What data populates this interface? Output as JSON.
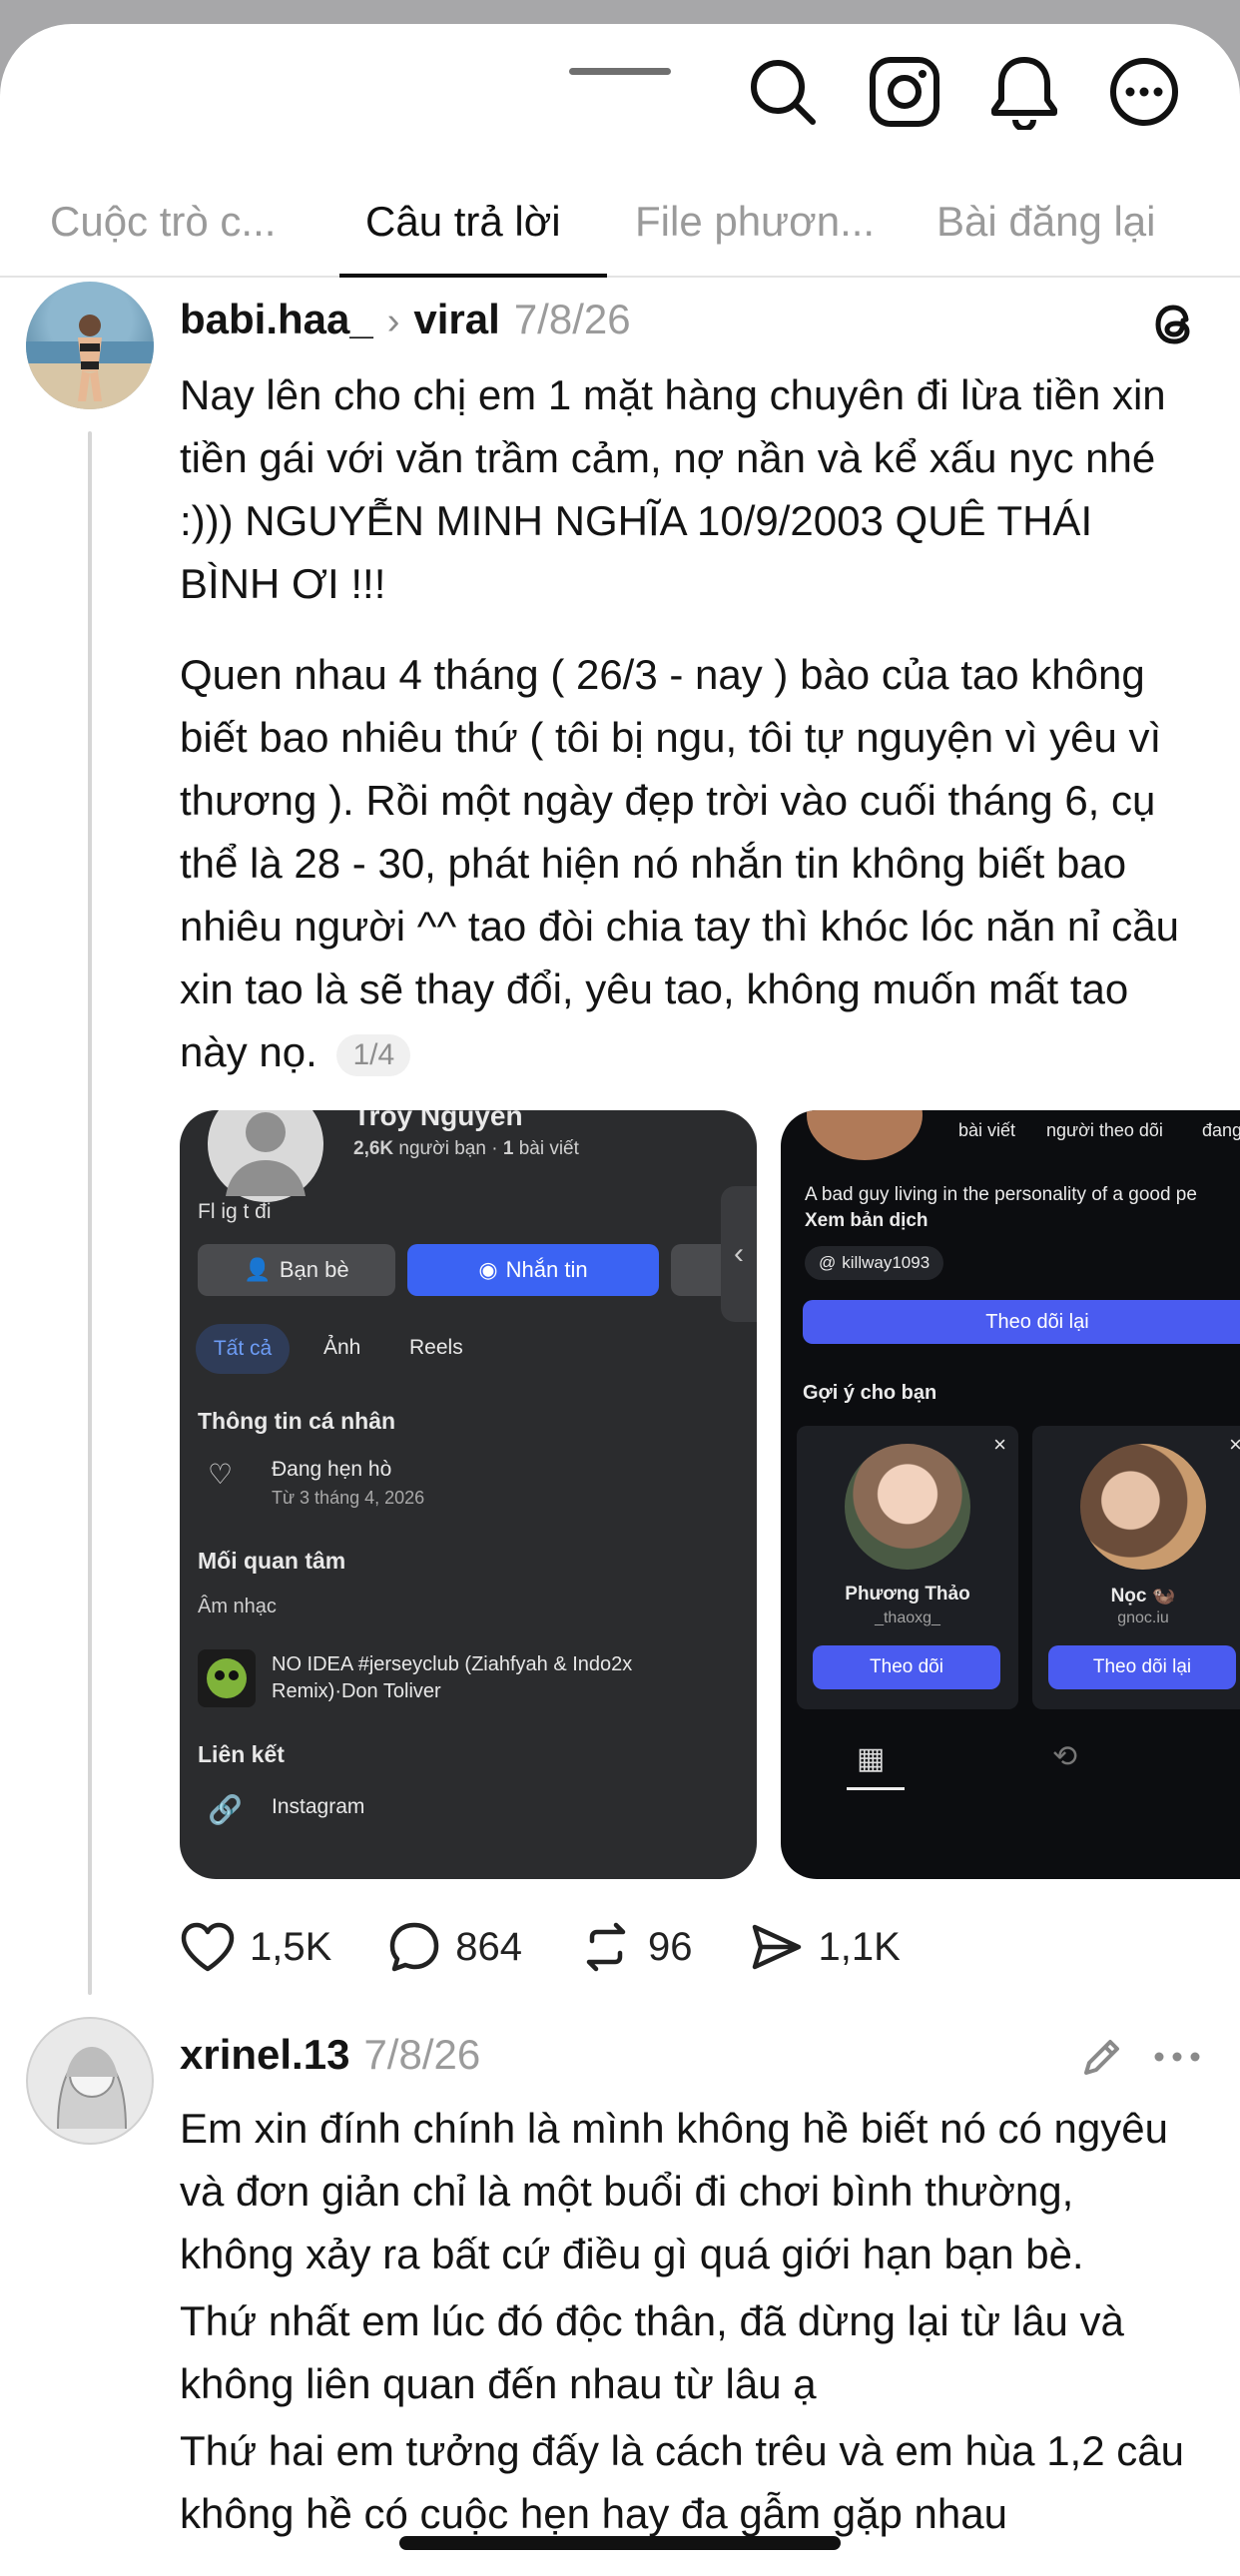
{
  "tabs": [
    "Cuộc trò c...",
    "Câu trả lời",
    "File phươn...",
    "Bài đăng lại"
  ],
  "post1": {
    "username": "babi.haa_",
    "topic": "viral",
    "date": "7/8/26",
    "para1": "Nay lên cho chị em 1 mặt hàng chuyên đi lừa tiền xin tiền gái với văn trầm cảm, nợ nần và kể xấu nyc nhé :))) NGUYỄN MINH NGHĨA 10/9/2003 QUÊ THÁI BÌNH ƠI !!!",
    "para2": "Quen nhau 4 tháng ( 26/3 - nay ) bào của tao không biết bao nhiêu thứ ( tôi bị ngu, tôi tự nguyện vì yêu vì thương ). Rồi một ngày đẹp trời vào cuối tháng 6, cụ thể là 28 - 30, phát hiện nó nhắn tin không biết bao nhiêu người ^^ tao đòi chia tay thì khóc lóc năn nỉ cầu xin tao là sẽ thay đổi, yêu tao, không muốn mất tao này nọ.",
    "image_counter": "1/4",
    "likes": "1,5K",
    "comments": "864",
    "reposts": "96",
    "shares": "1,1K"
  },
  "fb_shot": {
    "name": "Troy Nguyen",
    "friends_count": "2,6K",
    "friends_label": "người bạn",
    "posts_sep": "·",
    "posts_count": "1",
    "posts_label": "bài viết",
    "bio": "Fl ig t đi",
    "btn_friends": "Bạn bè",
    "btn_message": "Nhắn tin",
    "tab_all": "Tất cả",
    "tab_photos": "Ảnh",
    "tab_reels": "Reels",
    "info_heading": "Thông tin cá nhân",
    "relationship": "Đang hẹn hò",
    "relationship_since": "Từ 3 tháng 4, 2026",
    "interests_heading": "Mối quan tâm",
    "music_label": "Âm nhạc",
    "song": "NO IDEA #jerseyclub (Ziahfyah & Indo2x Remix)·Don Toliver",
    "links_heading": "Liên kết",
    "instagram": "Instagram"
  },
  "ig_shot": {
    "stat_posts": "bài viết",
    "stat_followers": "người theo dõi",
    "stat_following": "đang",
    "bio": "A bad guy living in the personality of a good pe",
    "translate": "Xem bản dịch",
    "threads_handle": "killway1093",
    "follow_back": "Theo dõi lại",
    "suggest_heading": "Gợi ý cho bạn",
    "s1_name": "Phương Thảo",
    "s1_handle": "_thaoxg_",
    "s1_btn": "Theo dõi",
    "s2_name": "Nọc 🦦",
    "s2_handle": "gnoc.iu",
    "s2_btn": "Theo dõi lại"
  },
  "post2": {
    "username": "xrinel.13",
    "date": "7/8/26",
    "line1": "Em xin đính chính là mình không hề biết nó có ngyêu và đơn giản chỉ là một buổi đi chơi bình thường, không xảy ra bất cứ điều gì quá giới hạn bạn bè.",
    "line2": "Thứ nhất em lúc đó độc thân, đã dừng lại từ lâu và không liên quan đến nhau từ lâu ạ",
    "line3": "Thứ hai em tưởng đấy là cách trêu và em hùa 1,2 câu không hề có cuộc hẹn hay đa gẫm gặp nhau"
  },
  "colors": {
    "accent_blue": "#3b63f3",
    "text": "#141414",
    "muted": "#9b9b9b"
  },
  "icons": [
    "search-icon",
    "instagram-icon",
    "bell-icon",
    "more-icon",
    "threads-icon",
    "heart-icon",
    "comment-icon",
    "repost-icon",
    "share-icon",
    "edit-icon"
  ]
}
